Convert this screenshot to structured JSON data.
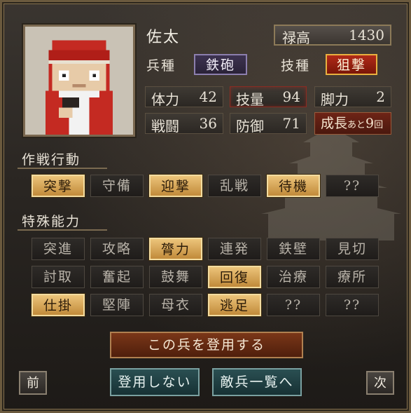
{
  "unit": {
    "name": "佐太",
    "stipend_label": "禄高",
    "stipend_value": "1430",
    "type_label": "兵種",
    "type_value": "鉄砲",
    "skill_label": "技種",
    "skill_value": "狙撃"
  },
  "stats": {
    "hp_label": "体力",
    "hp_value": "42",
    "tech_label": "技量",
    "tech_value": "94",
    "legs_label": "脚力",
    "legs_value": "2",
    "combat_label": "戦闘",
    "combat_value": "36",
    "defense_label": "防御",
    "defense_value": "71",
    "growth_label": "成長",
    "growth_prefix": "あと",
    "growth_value": "9",
    "growth_suffix": "回"
  },
  "tactics": {
    "title": "作戦行動",
    "buttons": [
      {
        "label": "突撃",
        "active": true
      },
      {
        "label": "守備",
        "active": false
      },
      {
        "label": "迎撃",
        "active": true
      },
      {
        "label": "乱戦",
        "active": false
      },
      {
        "label": "待機",
        "active": true
      },
      {
        "label": "??",
        "active": false
      }
    ]
  },
  "abilities": {
    "title": "特殊能力",
    "buttons": [
      {
        "label": "突進",
        "active": false
      },
      {
        "label": "攻略",
        "active": false
      },
      {
        "label": "膂力",
        "active": true
      },
      {
        "label": "連発",
        "active": false
      },
      {
        "label": "鉄壁",
        "active": false
      },
      {
        "label": "見切",
        "active": false
      },
      {
        "label": "討取",
        "active": false
      },
      {
        "label": "奮起",
        "active": false
      },
      {
        "label": "鼓舞",
        "active": false
      },
      {
        "label": "回復",
        "active": true
      },
      {
        "label": "治療",
        "active": false
      },
      {
        "label": "療所",
        "active": false
      },
      {
        "label": "仕掛",
        "active": true
      },
      {
        "label": "堅陣",
        "active": false
      },
      {
        "label": "母衣",
        "active": false
      },
      {
        "label": "逃足",
        "active": true
      },
      {
        "label": "??",
        "active": false
      },
      {
        "label": "??",
        "active": false
      }
    ]
  },
  "actions": {
    "recruit": "この兵を登用する",
    "decline": "登用しない",
    "enemy_list": "敵兵一覧へ",
    "prev": "前",
    "next": "次"
  },
  "colors": {
    "active_button": "#d9a656",
    "inactive_button": "#26231f",
    "skill_chip": "#a3251a",
    "type_chip": "#352c46"
  },
  "icons": {
    "portrait": "musketeer-pixel-portrait",
    "background": "castle-silhouette"
  }
}
